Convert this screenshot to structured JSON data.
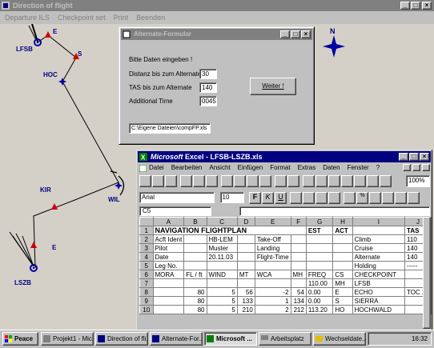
{
  "main_window": {
    "title": "Direction of flight",
    "menu": [
      "Departure ILS",
      "Checkpoint set",
      "Print",
      "Beenden"
    ]
  },
  "map": {
    "labels": {
      "lfsb": "LFSB",
      "e1": "E",
      "s": "S",
      "hoc": "HOC",
      "kir": "KIR",
      "wil": "WIL",
      "e2": "E",
      "lszb": "LSZB",
      "north": "N"
    },
    "colors": {
      "route": "#000000",
      "ils": "#0000a0",
      "checkpoint": "#d00000",
      "label": "#000080"
    }
  },
  "dialog": {
    "title": "Alternate-Formular",
    "prompt": "Bitte Daten eingeben !",
    "fields": [
      {
        "label": "Distanz bis zum Alternate",
        "value": "30"
      },
      {
        "label": "TAS bis zum Alternate",
        "value": "140"
      },
      {
        "label": "Additional Time",
        "value": "0045"
      }
    ],
    "next_button": "Weiter !",
    "path": "C:\\Eigene Dateien\\compFP.xls"
  },
  "excel": {
    "title": "Microsoft Excel - LFSB-LSZB.xls",
    "title_brand": "Microsoft",
    "title_rest": " Excel - LFSB-LSZB.xls",
    "menu": [
      "Datei",
      "Bearbeiten",
      "Ansicht",
      "Einfügen",
      "Format",
      "Extras",
      "Daten",
      "Fenster",
      "?"
    ],
    "font": "Arial",
    "font_size": "10",
    "zoom": "100%",
    "name_box": "C5",
    "columns": [
      "A",
      "B",
      "C",
      "D",
      "E",
      "F",
      "G",
      "H",
      "I",
      "J"
    ],
    "rows": [
      [
        "1",
        "NAVIGATION FLIGHTPLAN",
        "",
        "",
        "",
        "",
        "",
        "EST",
        "ACT",
        "",
        "TAS"
      ],
      [
        "2",
        "Acft Ident",
        "",
        "HB-LEM",
        "",
        "Take-Off",
        "",
        "",
        "",
        "Climb",
        "110"
      ],
      [
        "3",
        "Pilot",
        "",
        "Muster",
        "",
        "Landing",
        "",
        "",
        "",
        "Cruise",
        "140"
      ],
      [
        "4",
        "Date",
        "",
        "20.11.03",
        "",
        "Flight-Time",
        "",
        "",
        "",
        "Alternate",
        "140"
      ],
      [
        "5",
        "Leg No.",
        "",
        "",
        "",
        "",
        "",
        "",
        "",
        "Holding",
        "-----"
      ],
      [
        "6",
        "MORA",
        "FL / ft",
        "WIND",
        "MT",
        "WCA",
        "MH",
        "FREQ",
        "CS",
        "CHECKPOINT",
        ""
      ],
      [
        "7",
        "",
        "",
        "",
        "",
        "",
        "",
        "110.00",
        "MH",
        "LFSB",
        ""
      ],
      [
        "8",
        "",
        "80",
        "5",
        "56",
        "-2",
        "54",
        "0.00",
        "E",
        "ECHO",
        "TOC 25"
      ],
      [
        "9",
        "",
        "80",
        "5",
        "133",
        "1",
        "134",
        "0.00",
        "S",
        "SIERRA",
        ""
      ],
      [
        "10",
        "",
        "80",
        "5",
        "210",
        "2",
        "212",
        "113.20",
        "HO",
        "HOCHWALD",
        ""
      ]
    ]
  },
  "taskbar": {
    "start": "Peace",
    "tasks": [
      "Projekt1 - Mic...",
      "Direction of fli...",
      "Alternate-For...",
      "Microsoft ...",
      "Arbeitsplatz",
      "Wechseldate..."
    ],
    "clock": "16:32"
  }
}
